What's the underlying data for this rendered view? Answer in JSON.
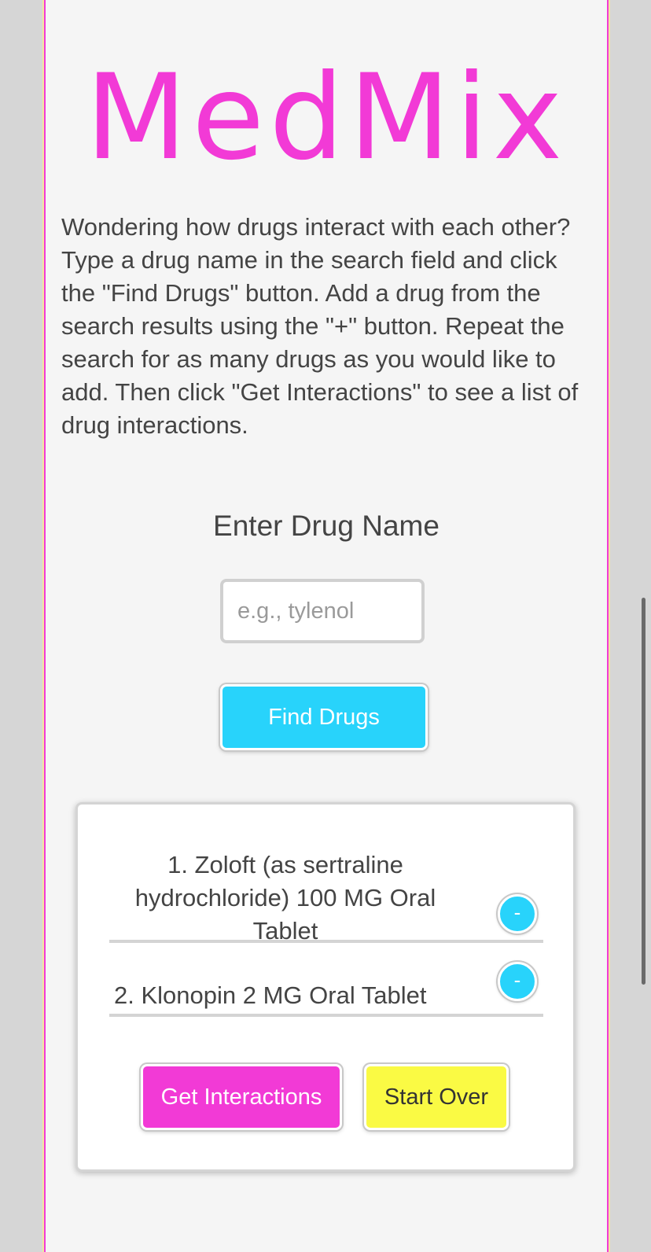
{
  "header": {
    "logo_text": "MedMix"
  },
  "intro": {
    "text": "Wondering how drugs interact with each other? Type a drug name in the search field and click the \"Find Drugs\" button. Add a drug from the search results using the \"+\" button. Repeat the search for as many drugs as you would like to add. Then click \"Get Interactions\" to see a list of drug interactions."
  },
  "search": {
    "label": "Enter Drug Name",
    "placeholder": "e.g., tylenol",
    "value": "",
    "button_label": "Find Drugs"
  },
  "selected_drugs": {
    "items": [
      {
        "label": "1. Zoloft (as sertraline hydrochloride) 100 MG Oral Tablet",
        "remove_label": "-"
      },
      {
        "label": "2. Klonopin 2 MG Oral Tablet",
        "remove_label": "-"
      }
    ],
    "get_interactions_label": "Get Interactions",
    "start_over_label": "Start Over"
  },
  "colors": {
    "brand_pink": "#f23ad6",
    "accent_cyan": "#28d3fb",
    "accent_yellow": "#fafa44"
  },
  "icons": {
    "remove": "minus-icon"
  }
}
